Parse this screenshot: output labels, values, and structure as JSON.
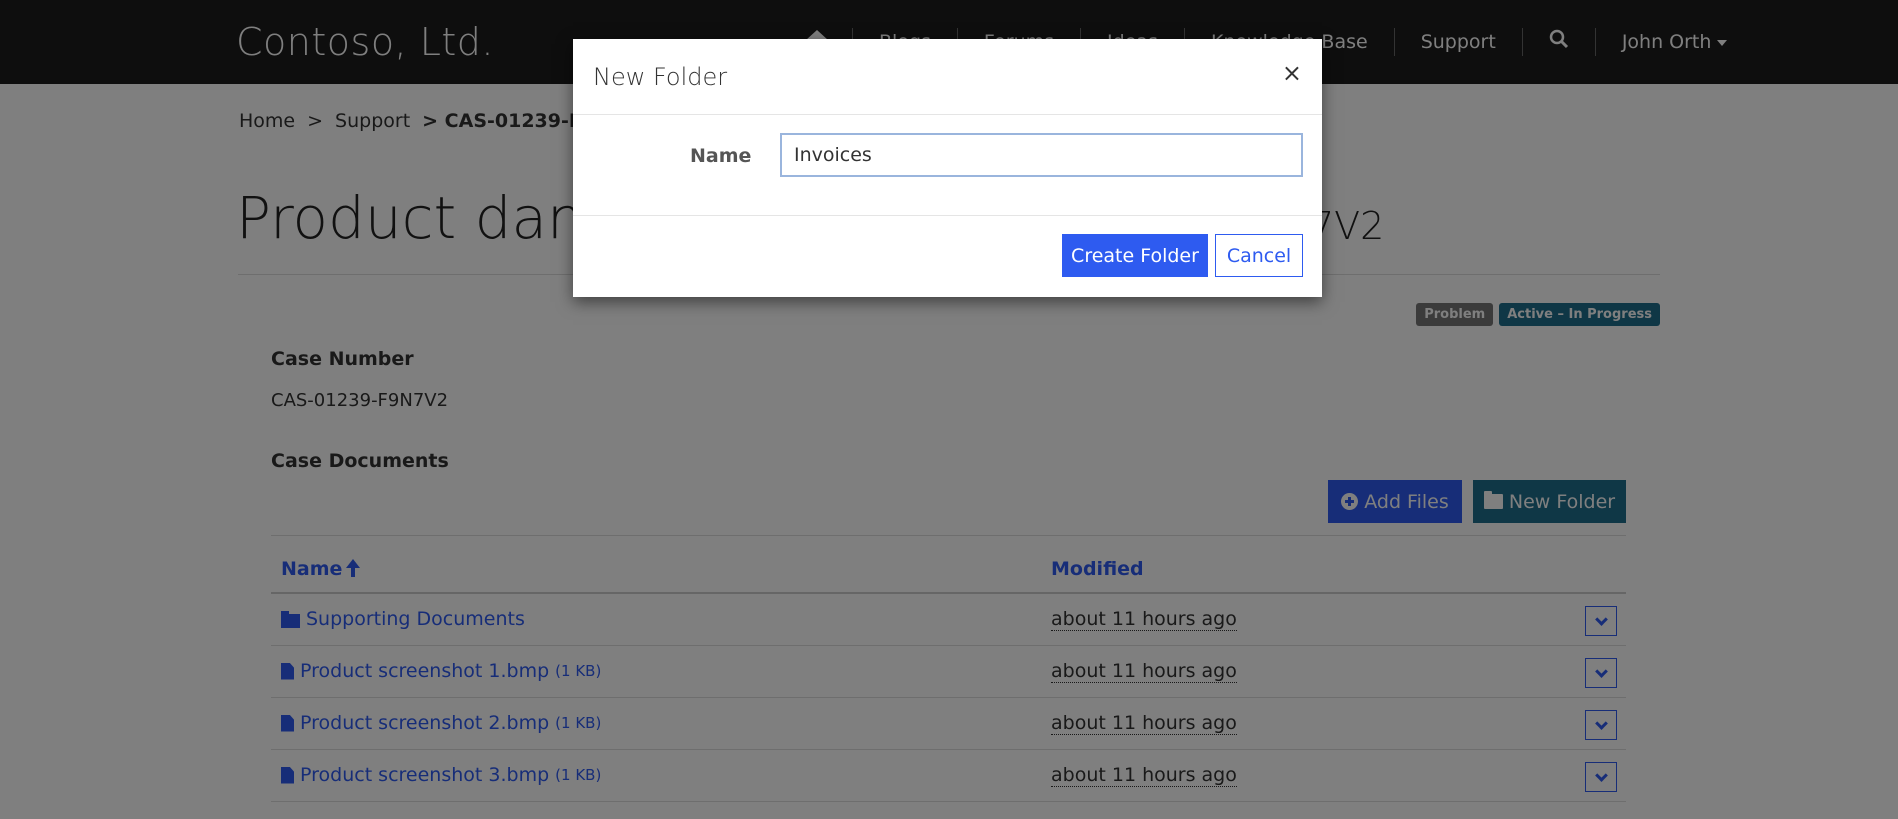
{
  "navbar": {
    "brand": "Contoso, Ltd.",
    "items": [
      "Blogs",
      "Forums",
      "Ideas",
      "Knowledge Base",
      "Support"
    ],
    "user": "John Orth"
  },
  "breadcrumb": {
    "home": "Home",
    "sep1": ">",
    "support": "Support",
    "current": "> CAS-01239-F9N7V2"
  },
  "page": {
    "title": "Product damag",
    "title_suffix": "7V2",
    "badges": {
      "problem": "Problem",
      "status": "Active – In Progress"
    },
    "case_number_label": "Case Number",
    "case_number_value": "CAS-01239-F9N7V2",
    "case_documents_label": "Case Documents",
    "add_files_label": "Add Files",
    "new_folder_label": "New Folder"
  },
  "table": {
    "col_name": "Name",
    "col_modified": "Modified",
    "rows": [
      {
        "type": "folder",
        "name": "Supporting Documents",
        "size": "",
        "modified": "about 11 hours ago"
      },
      {
        "type": "file",
        "name": "Product screenshot 1.bmp",
        "size": "(1 KB)",
        "modified": "about 11 hours ago"
      },
      {
        "type": "file",
        "name": "Product screenshot 2.bmp",
        "size": "(1 KB)",
        "modified": "about 11 hours ago"
      },
      {
        "type": "file",
        "name": "Product screenshot 3.bmp",
        "size": "(1 KB)",
        "modified": "about 11 hours ago"
      }
    ]
  },
  "modal": {
    "title": "New Folder",
    "close": "×",
    "name_label": "Name",
    "name_value": "Invoices",
    "create_label": "Create Folder",
    "cancel_label": "Cancel"
  },
  "colors": {
    "navbar": "#1c1c1c",
    "primary": "#2e5bf0",
    "teal": "#1f6e8c"
  }
}
